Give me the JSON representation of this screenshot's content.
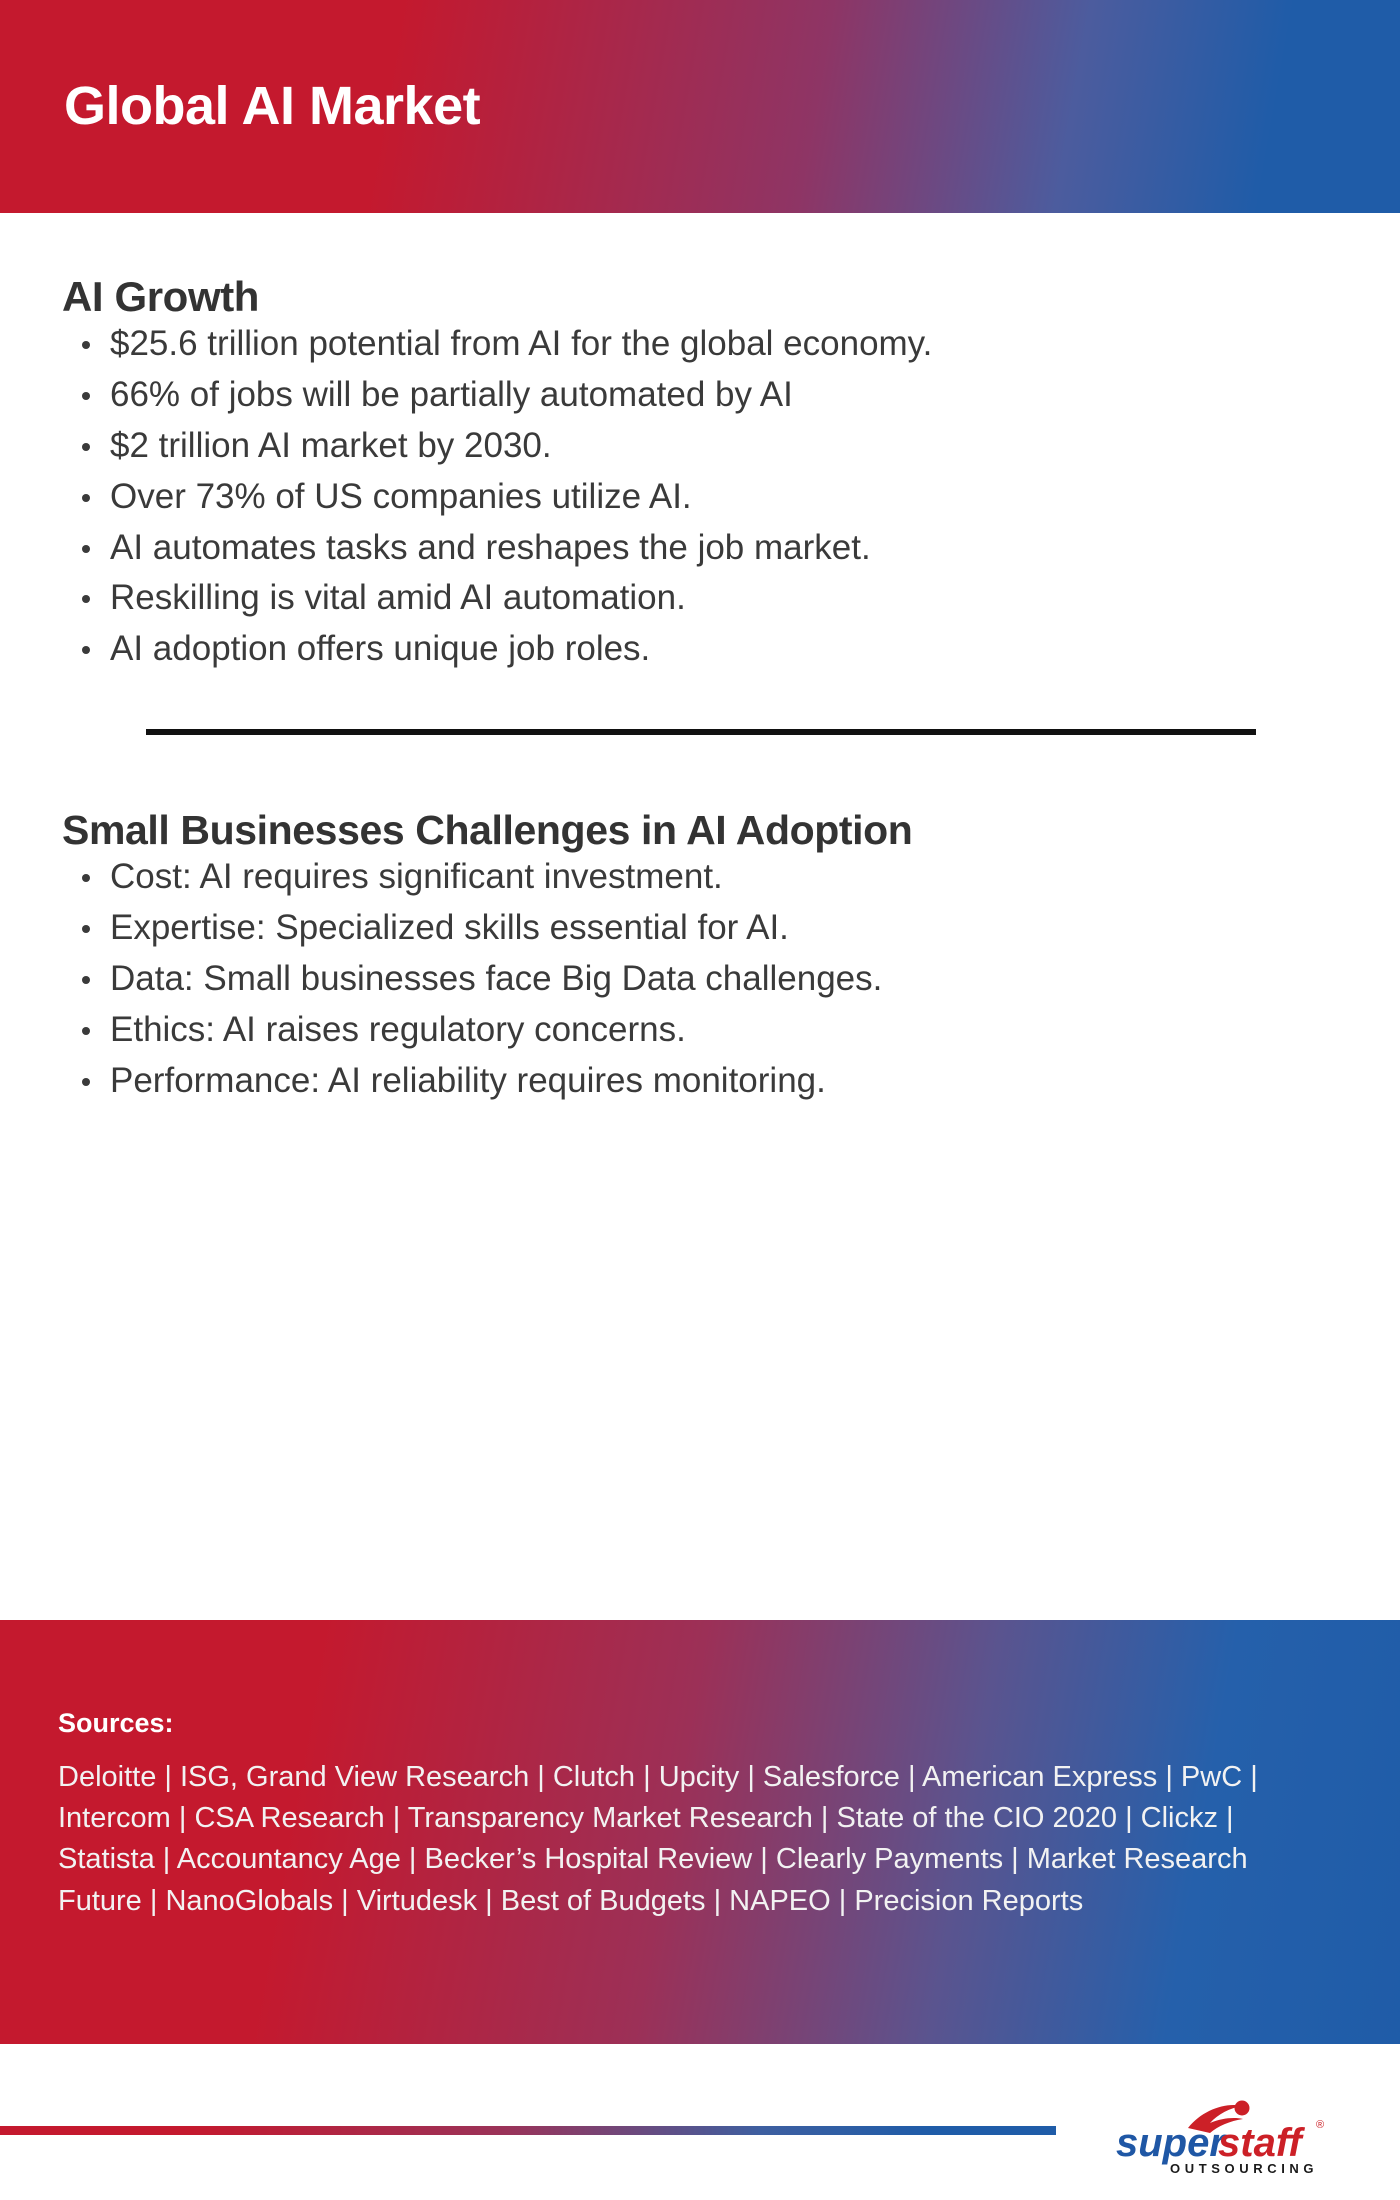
{
  "header": {
    "title": "Global AI Market",
    "gradient_from": "#C4192E",
    "gradient_to": "#1F5CA8"
  },
  "sections": [
    {
      "heading": "AI Growth",
      "bullets": [
        "$25.6 trillion potential from AI for the global economy.",
        "66% of jobs will be partially automated by AI",
        "$2 trillion AI market by 2030.",
        "Over 73% of US companies utilize AI.",
        "AI automates tasks and reshapes the job market.",
        "Reskilling is vital amid AI automation.",
        "AI adoption offers unique job roles."
      ]
    },
    {
      "heading": "Small Businesses Challenges in AI Adoption",
      "bullets": [
        "Cost: AI requires significant investment.",
        "Expertise: Specialized skills essential for AI.",
        "Data: Small businesses face Big Data challenges.",
        "Ethics: AI raises regulatory concerns.",
        "Performance: AI reliability requires monitoring."
      ]
    }
  ],
  "sources": {
    "label": "Sources:",
    "text": "Deloitte | ISG, Grand View Research | Clutch | Upcity | Salesforce | American Express | PwC | Intercom | CSA Research | Transparency Market Research | State of the CIO 2020 | Clickz | Statista | Accountancy Age | Becker’s Hospital Review | Clearly Payments | Market Research Future | NanoGlobals | Virtudesk | Best of Budgets | NAPEO | Precision Reports"
  },
  "logo": {
    "word_one": "super",
    "word_two": "staff",
    "tagline": "OUTSOURCING",
    "registered_mark": "®",
    "blue": "#1F57A5",
    "red": "#CC2027"
  }
}
